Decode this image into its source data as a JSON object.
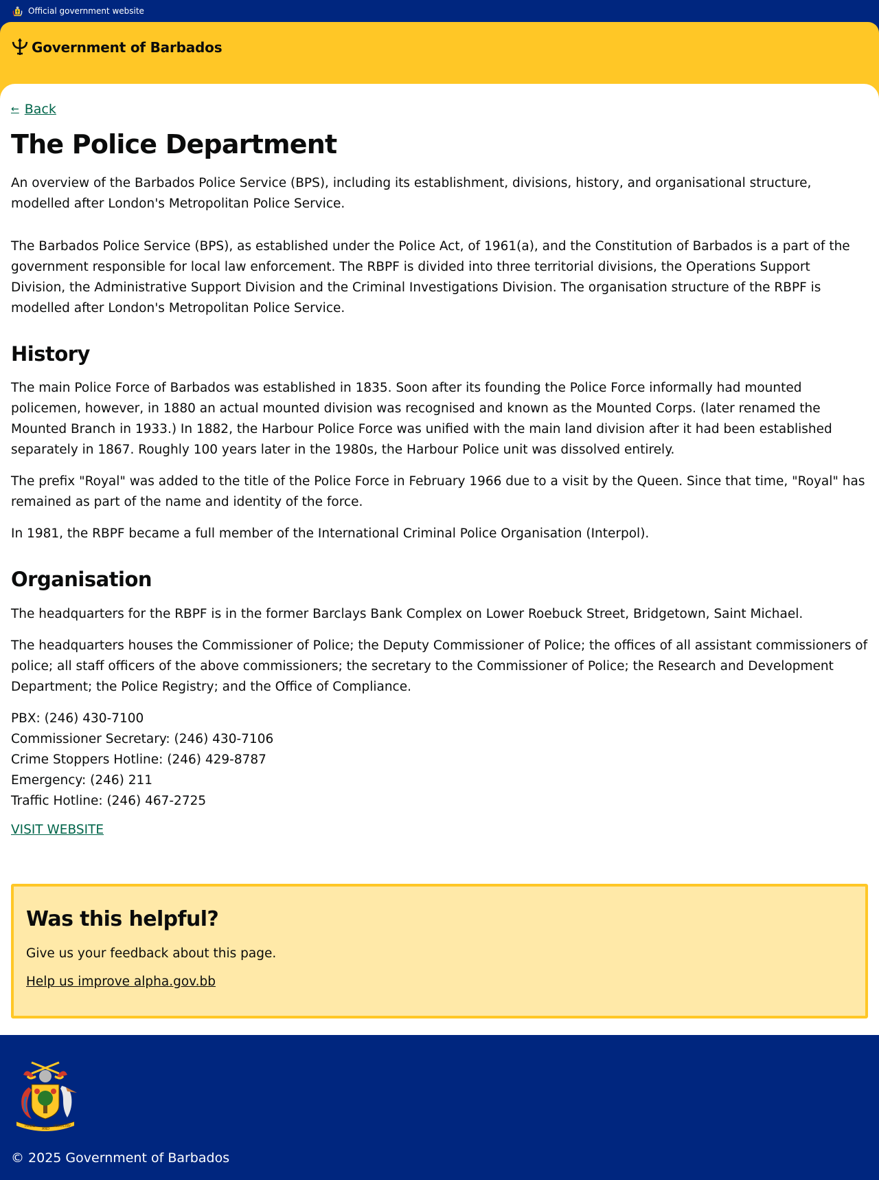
{
  "topbar": {
    "label": "Official government website",
    "icon": "coat-of-arms-icon"
  },
  "header": {
    "brand": "Government of Barbados",
    "icon": "trident-icon",
    "color": "#ffc726"
  },
  "nav": {
    "back_label": "Back",
    "back_icon": "arrow-left-icon"
  },
  "page": {
    "title": "The Police Department",
    "lead": "An overview of the Barbados Police Service (BPS), including its establishment, divisions, history, and organisational structure, modelled after London's Metropolitan Police Service.",
    "intro": "The Barbados Police Service (BPS), as established under the Police Act, of 1961(a), and the Constitution of Barbados is a part of the government responsible for local law enforcement. The RBPF is divided into three territorial divisions, the Operations Support Division, the Administrative Support Division and the Criminal Investigations Division. The organisation structure of the RBPF is modelled after London's Metropolitan Police Service.",
    "history_heading": "History",
    "history_paragraphs": [
      "The main Police Force of Barbados was established in 1835. Soon after its founding the Police Force informally had mounted policemen, however, in 1880 an actual mounted division was recognised and known as the Mounted Corps. (later renamed the Mounted Branch in 1933.) In 1882, the Harbour Police Force was unified with the main land division after it had been established separately in 1867. Roughly 100 years later in the 1980s, the Harbour Police unit was dissolved entirely.",
      "The prefix \"Royal\" was added to the title of the Police Force in February 1966 due to a visit by the Queen. Since that time, \"Royal\" has remained as part of the name and identity of the force.",
      "In 1981, the RBPF became a full member of the International Criminal Police Organisation (Interpol)."
    ],
    "organisation_heading": "Organisation",
    "organisation_paragraphs": [
      "The headquarters for the RBPF is in the former Barclays Bank Complex on Lower Roebuck Street, Bridgetown, Saint Michael.",
      "The headquarters houses the Commissioner of Police; the Deputy Commissioner of Police; the offices of all assistant commissioners of police; all staff officers of the above commissioners; the secretary to the Commissioner of Police; the Research and Development Department; the Police Registry; and the Office of Compliance."
    ],
    "contacts": [
      "PBX: (246) 430-7100",
      "Commissioner Secretary: (246) 430-7106",
      "Crime Stoppers Hotline: (246) 429-8787",
      "Emergency: (246) 211",
      "Traffic Hotline: (246) 467-2725"
    ],
    "visit_label": "VISIT WEBSITE"
  },
  "feedback": {
    "heading": "Was this helpful?",
    "text": "Give us your feedback about this page.",
    "link": "Help us improve alpha.gov.bb"
  },
  "footer": {
    "copyright": "© 2025 Government of Barbados",
    "crest_icon": "coat-of-arms-icon",
    "crest_motto_words": [
      "PRIDE",
      "AND",
      "INDUSTRY"
    ]
  },
  "colors": {
    "navy": "#00267f",
    "gold": "#ffc726",
    "link": "#00654a",
    "feedback_bg": "#ffe9a8"
  }
}
